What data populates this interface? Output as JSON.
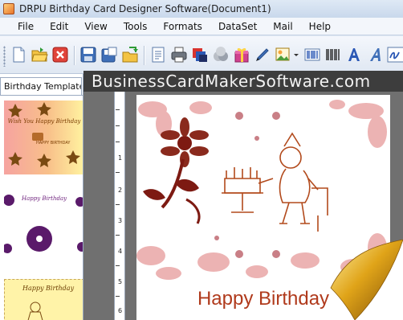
{
  "window": {
    "title": "DRPU Birthday Card Designer Software(Document1)"
  },
  "menu": {
    "items": [
      "File",
      "Edit",
      "View",
      "Tools",
      "Formats",
      "DataSet",
      "Mail",
      "Help"
    ]
  },
  "toolbar": {
    "buttons": [
      "new-icon",
      "open-icon",
      "close-icon",
      "save-icon",
      "save-as-icon",
      "export-icon",
      "properties-icon",
      "print-icon",
      "layers-icon",
      "shapes-icon",
      "gift-icon",
      "pen-icon",
      "image-icon",
      "barcode-icon",
      "barcode-alt-icon",
      "text-icon",
      "wordart-icon",
      "signature-icon"
    ]
  },
  "watermark": {
    "text": "BusinessCardMakerSoftware.com"
  },
  "left_panel": {
    "tab_label": "Birthday Templates",
    "templates": [
      {
        "title": "Wish You Happy Birthday",
        "subtitle": "HAPPY BIRTHDAY"
      },
      {
        "title": "Happy Birthday"
      },
      {
        "title": "Happy Birthday"
      }
    ]
  },
  "ruler": {
    "labels": [
      "1",
      "2",
      "3",
      "4",
      "5",
      "6"
    ]
  },
  "card": {
    "caption": "Happy Birthday"
  },
  "colors": {
    "accent": "#b03a1c",
    "workspace": "#707070",
    "watermark_bg": "#3d3d3d"
  }
}
